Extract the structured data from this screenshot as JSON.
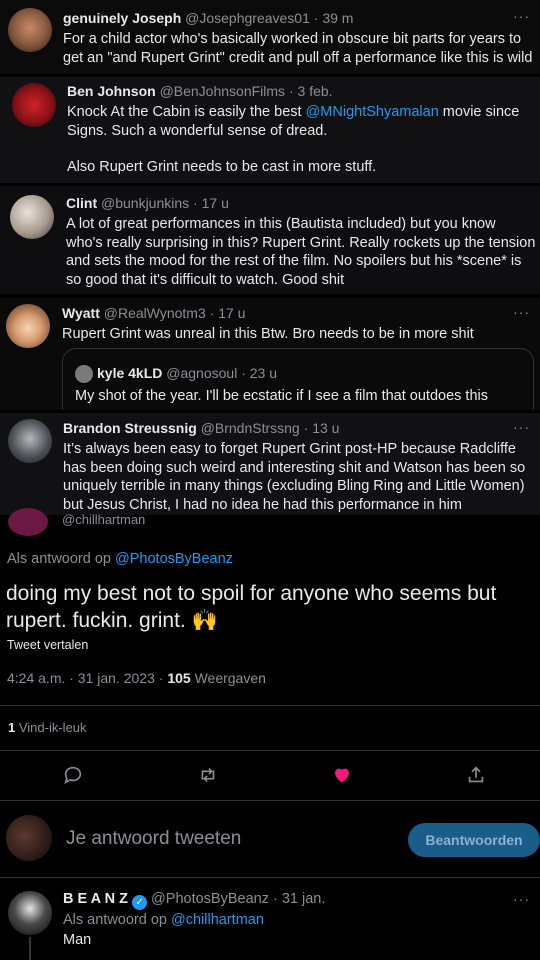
{
  "tweets": [
    {
      "name": "genuinely Joseph",
      "handle": "@Josephgreaves01",
      "time": "39 m",
      "text": "For a child actor who's basically worked in obscure bit parts for years to get an \"and Rupert Grint\" credit and  pull off a performance like this is wild"
    },
    {
      "name": "Ben Johnson",
      "handle": "@BenJohnsonFilms",
      "time": "3 feb.",
      "text_a": "Knock At the Cabin is easily the best ",
      "mention": "@MNightShyamalan",
      "text_b": " movie since Signs. Such a wonderful sense of dread.",
      "text_c": "Also Rupert Grint needs to be cast in more stuff."
    },
    {
      "name": "Clint",
      "handle": "@bunkjunkins",
      "time": "17 u",
      "text": "A lot of great performances in this (Bautista included) but you know who's really surprising in this? Rupert Grint. Really rockets up the tension and sets the mood for the rest of the film. No spoilers but his *scene* is so good that it's difficult to watch. Good shit"
    },
    {
      "name": "Wyatt",
      "handle": "@RealWynotm3",
      "time": "17 u",
      "text": "Rupert Grint was unreal in this Btw. Bro needs to be in more shit",
      "quote": {
        "name": "kyle 4kLD",
        "handle": "@agnosoul",
        "time": "23 u",
        "text": "My shot of the year. I'll be ecstatic if I see a film that outdoes this"
      }
    },
    {
      "name": "Brandon Streussnig",
      "handle": "@BrndnStrssng",
      "time": "13 u",
      "text": "It’s always been easy to forget Rupert Grint post-HP because Radcliffe has been doing such weird and interesting shit and Watson has been so uniquely terrible in many things (excluding Bling Ring and Little Women) but Jesus Christ, I had no idea he had this performance in him"
    }
  ],
  "cut_handle": "@chillhartman",
  "main": {
    "reply_prefix": "Als antwoord op ",
    "reply_handle": "@PhotosByBeanz",
    "text": "doing my best not to spoil for anyone who seems but rupert. fuckin. grint. 🙌",
    "translate": "Tweet vertalen",
    "timestamp": "4:24 a.m. · 31 jan. 2023 · ",
    "views_count": "105",
    "views_label": " Weergaven",
    "likes_count": "1",
    "likes_label": " Vind-ik-leuk"
  },
  "actions": {
    "reply": "reply-icon",
    "retweet": "retweet-icon",
    "like": "heart-icon",
    "share": "share-icon",
    "like_color": "#f91880"
  },
  "composer": {
    "placeholder": "Je antwoord tweeten",
    "button": "Beantwoorden"
  },
  "bottom_tweet": {
    "name": "B E A N Z",
    "handle": "@PhotosByBeanz",
    "time": "31 jan.",
    "reply_prefix": "Als antwoord op ",
    "reply_handle": "@chillhartman",
    "text": "Man"
  }
}
